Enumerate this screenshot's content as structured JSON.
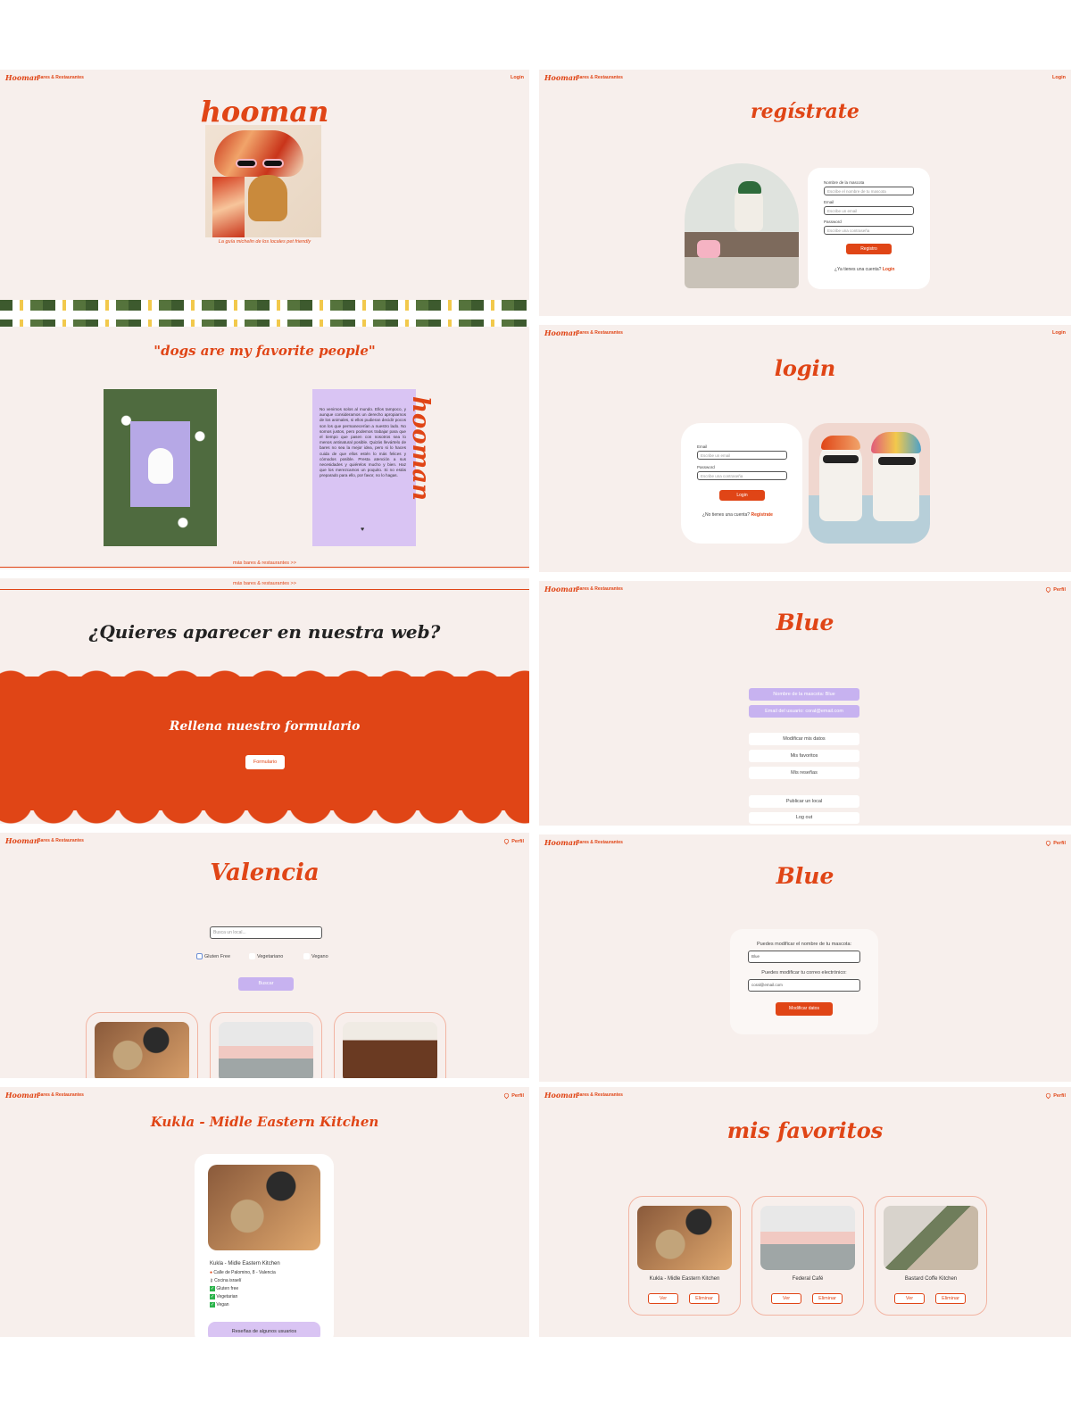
{
  "brand": {
    "logo": "Hooman",
    "subtitle": "Bares & Restaurantes",
    "login_link": "Login",
    "profile_link": "Perfil",
    "accent_color": "#e04516",
    "lavender_color": "#c7b2f0",
    "background_color": "#f7efec"
  },
  "home": {
    "title": "hooman",
    "tagline": "La guía michelin de los locales pet friendly"
  },
  "quote": {
    "title": "\"dogs are my favorite people\"",
    "body": "No venimos solos al mundo. Ellos tampoco, y aunque consideramos un derecho apropiarnos de los animales, si ellos pudieran decidir pocos son los que permanecerían a nuestro lado. No somos justos, pero podemos trabajar para que el tiempo que pasen con nosotros sea lo menos antinatural posible. Quizás llevártelo de bares no sea la mejor idea, pero si lo haces cuida de que ellos estén lo más felices y cómodos posible. Presta atención a sus necesidades y quiérelos mucho y bien. Haz que los merezcamos un poquito. Si no estás preparado para ello, por favor, no lo hagas.",
    "side_word": "hooman",
    "heart": "♥",
    "more_link": "más bares & restaurantes >>"
  },
  "cta": {
    "more_link": "más bares & restaurantes >>",
    "question": "¿Quieres aparecer en nuestra web?",
    "subtitle": "Rellena nuestro formulario",
    "button": "Formulario"
  },
  "register": {
    "title": "regístrate",
    "pet_label": "Nombre de la mascota",
    "pet_placeholder": "Escribe el nombre de tu mascota",
    "email_label": "Email",
    "email_placeholder": "Escribe un email",
    "password_label": "Password",
    "password_placeholder": "Escribe una contraseña",
    "button": "Registro",
    "question": "¿Ya tienes una cuenta?",
    "link": "Login"
  },
  "login": {
    "title": "login",
    "email_label": "Email",
    "email_placeholder": "Escribe un email",
    "password_label": "Password",
    "password_placeholder": "Escribe una contraseña",
    "button": "Login",
    "question": "¿No tienes una cuenta?",
    "link": "Regístrate"
  },
  "profile": {
    "title": "Blue",
    "pet_name": "Nombre de la mascota: Blue",
    "user_email": "Email del usuario: coral@email.com",
    "options": [
      "Modificar mis datos",
      "Mis favoritos",
      "Mis reseñas"
    ],
    "publish": "Publicar un local",
    "logout": "Log out"
  },
  "edit": {
    "title": "Blue",
    "name_label": "Puedes modificar el nombre de tu mascota:",
    "name_value": "Blue",
    "email_label": "Puedes modificar tu correo electrónico:",
    "email_value": "coral@email.com",
    "button": "Modificar datos"
  },
  "city": {
    "title": "Valencia",
    "search_placeholder": "Busca un local...",
    "filters": [
      "Gluten Free",
      "Vegetariano",
      "Vegano"
    ],
    "search_button": "Buscar"
  },
  "detail": {
    "title": "Kukla - Midle Eastern Kitchen",
    "name": "Kukla - Midle Eastern Kitchen",
    "address": "Calle de Palomino, 8 - Valencia",
    "cuisine": "Cocina israelí",
    "tags": [
      "Gluten free",
      "Vegetarian",
      "Vegan"
    ],
    "reviews_button": "Reseñas de algunos usuarios"
  },
  "favorites": {
    "title": "mis favoritos",
    "items": [
      {
        "name": "Kukla - Midle Eastern Kitchen"
      },
      {
        "name": "Federal Café"
      },
      {
        "name": "Bastard Coffe Kitchen"
      }
    ],
    "view": "Ver",
    "delete": "Eliminar"
  }
}
